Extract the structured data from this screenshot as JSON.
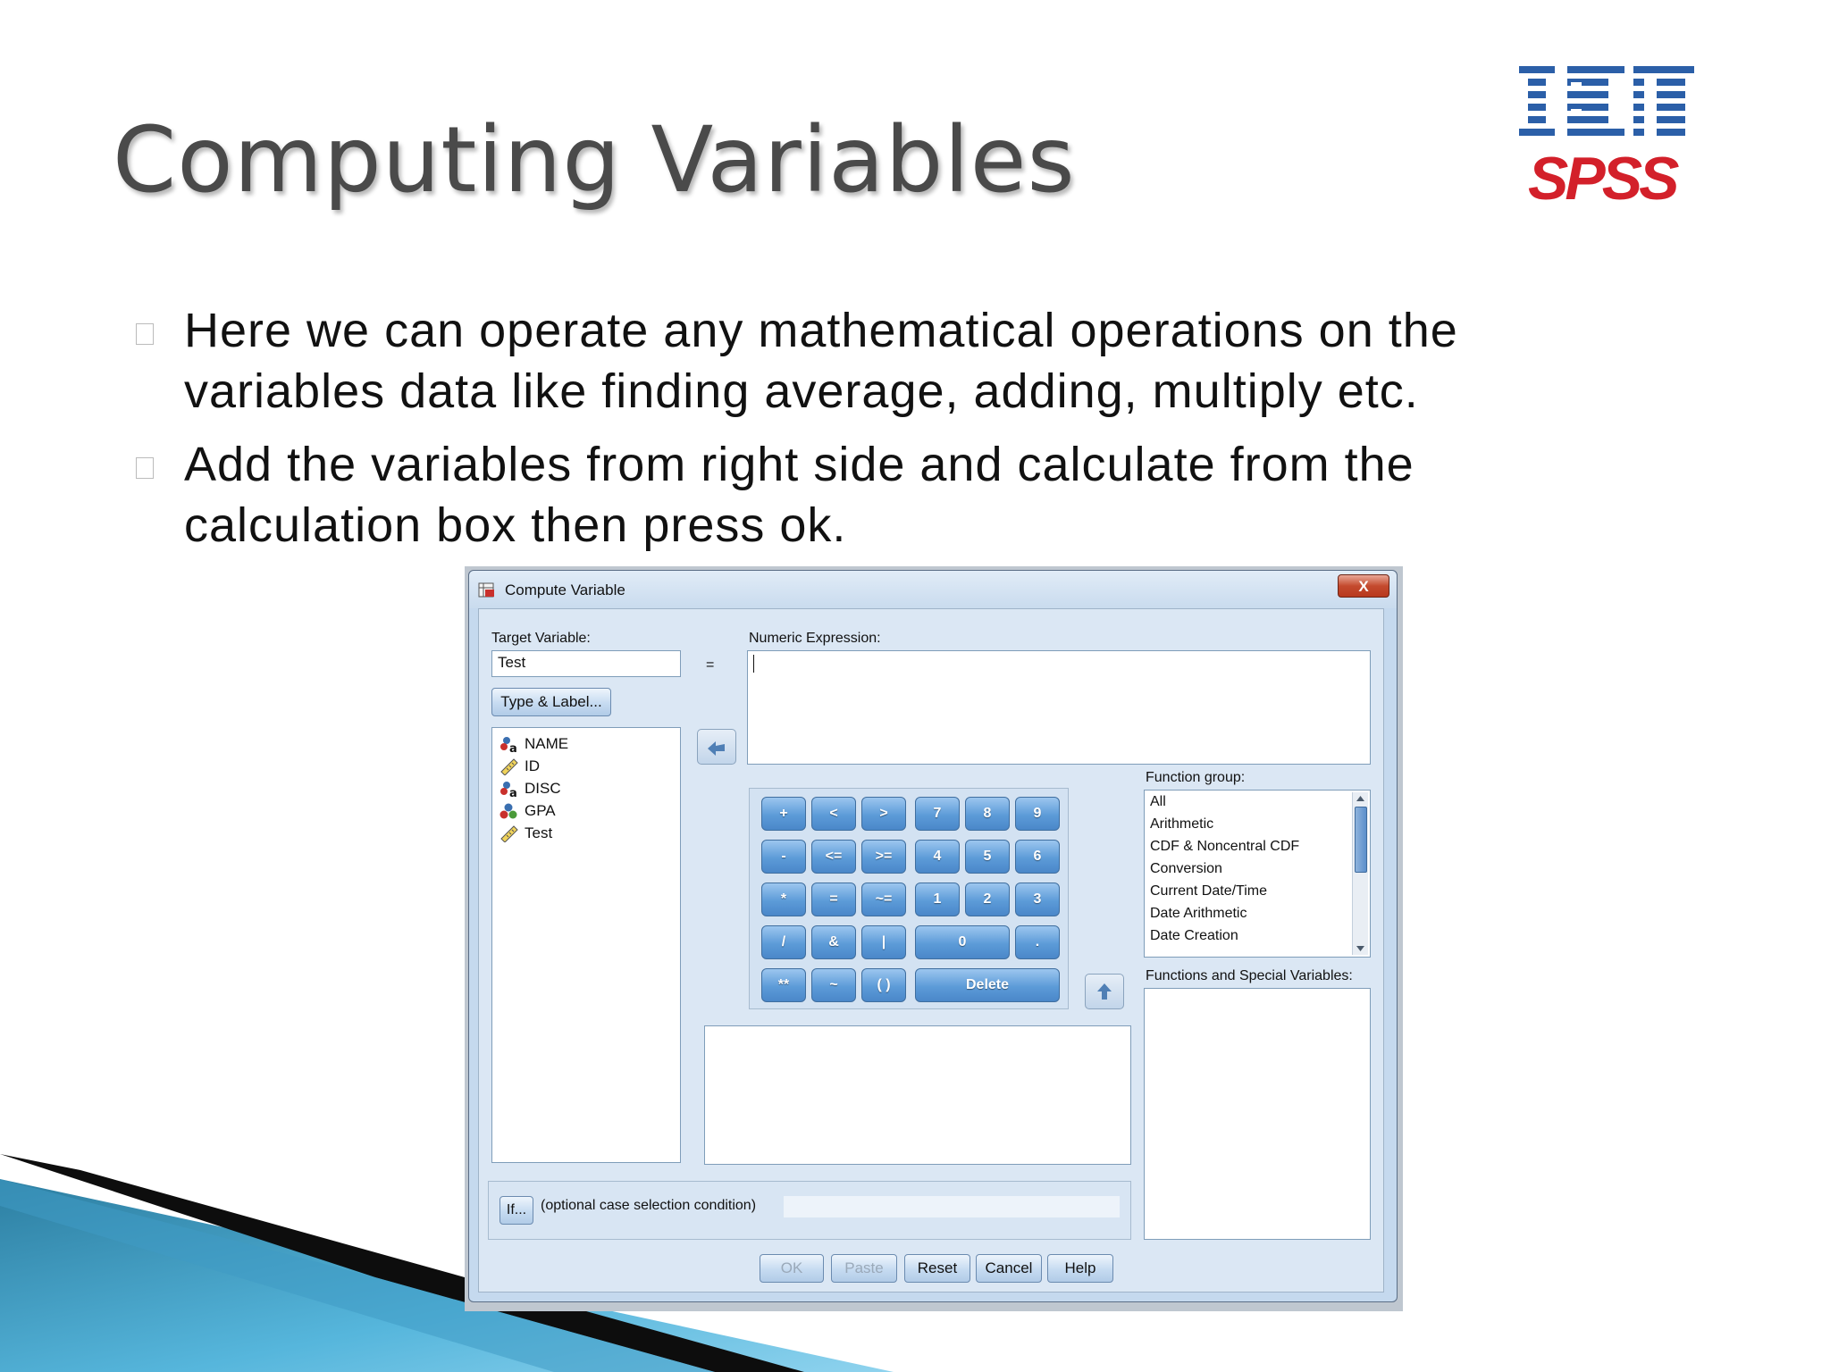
{
  "slide": {
    "title": "Computing Variables",
    "logo_spss": "SPSS",
    "bullets": [
      {
        "line1": "Here we can operate any mathematical operations on the",
        "line2": "variables data like finding average, adding, multiply etc."
      },
      {
        "line1": "Add the variables from right side and calculate from the",
        "line2": "calculation box then press ok."
      }
    ]
  },
  "dialog": {
    "title": "Compute Variable",
    "close_label": "X",
    "target_label": "Target Variable:",
    "target_value": "Test",
    "equals": "=",
    "numeric_label": "Numeric Expression:",
    "numeric_value": "",
    "type_label_button": "Type & Label...",
    "variables": [
      "NAME",
      "ID",
      "DISC",
      "GPA",
      "Test"
    ],
    "keypad": {
      "row1": [
        "+",
        "<",
        ">",
        "7",
        "8",
        "9"
      ],
      "row2": [
        "-",
        "<=",
        ">=",
        "4",
        "5",
        "6"
      ],
      "row3": [
        "*",
        "=",
        "~=",
        "1",
        "2",
        "3"
      ],
      "row4": [
        "/",
        "&",
        "|",
        "0",
        "."
      ],
      "row5": [
        "**",
        "~",
        "( )",
        "Delete"
      ]
    },
    "function_group_label": "Function group:",
    "function_groups": [
      "All",
      "Arithmetic",
      "CDF & Noncentral CDF",
      "Conversion",
      "Current Date/Time",
      "Date Arithmetic",
      "Date Creation"
    ],
    "functions_label": "Functions and Special Variables:",
    "if_button": "If...",
    "if_text": "(optional case selection condition)",
    "buttons": {
      "ok": "OK",
      "paste": "Paste",
      "reset": "Reset",
      "cancel": "Cancel",
      "help": "Help"
    }
  }
}
